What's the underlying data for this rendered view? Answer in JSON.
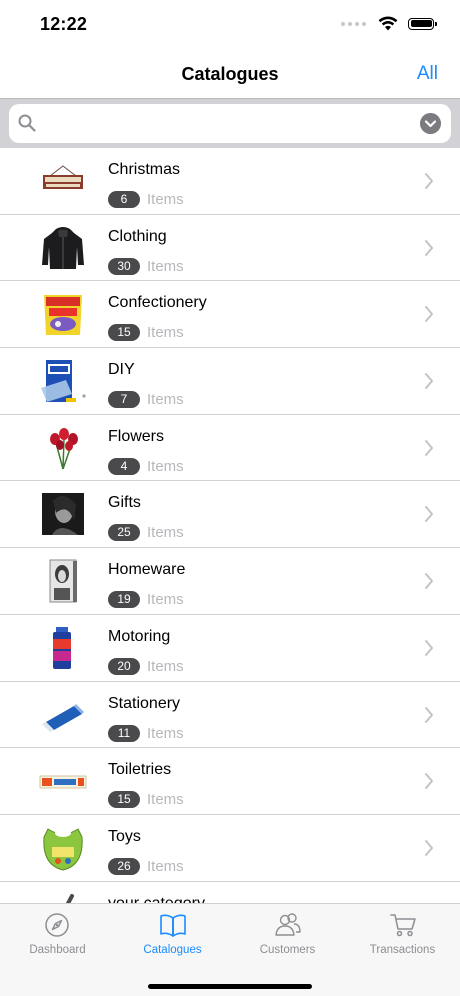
{
  "status_bar": {
    "time": "12:22"
  },
  "nav": {
    "title": "Catalogues",
    "right_button": "All"
  },
  "search": {
    "placeholder": "",
    "value": ""
  },
  "catalogues": [
    {
      "name": "Christmas",
      "count": "6",
      "items_label": "Items",
      "thumb": "be-merry-sign-thumbnail"
    },
    {
      "name": "Clothing",
      "count": "30",
      "items_label": "Items",
      "thumb": "hooded-jacket-thumbnail"
    },
    {
      "name": "Confectionery",
      "count": "15",
      "items_label": "Items",
      "thumb": "fries-sweets-thumbnail"
    },
    {
      "name": "DIY",
      "count": "7",
      "items_label": "Items",
      "thumb": "blu-tack-thumbnail"
    },
    {
      "name": "Flowers",
      "count": "4",
      "items_label": "Items",
      "thumb": "red-tulips-thumbnail"
    },
    {
      "name": "Gifts",
      "count": "25",
      "items_label": "Items",
      "thumb": "portrait-print-thumbnail"
    },
    {
      "name": "Homeware",
      "count": "19",
      "items_label": "Items",
      "thumb": "canvas-portrait-thumbnail"
    },
    {
      "name": "Motoring",
      "count": "20",
      "items_label": "Items",
      "thumb": "spray-can-thumbnail"
    },
    {
      "name": "Stationery",
      "count": "11",
      "items_label": "Items",
      "thumb": "eraser-thumbnail"
    },
    {
      "name": "Toiletries",
      "count": "15",
      "items_label": "Items",
      "thumb": "toothpaste-thumbnail"
    },
    {
      "name": "Toys",
      "count": "26",
      "items_label": "Items",
      "thumb": "baby-bib-thumbnail"
    },
    {
      "name": "your category",
      "count": "",
      "items_label": "",
      "thumb": "pen-thumbnail"
    }
  ],
  "tab_bar": {
    "tabs": [
      {
        "label": "Dashboard",
        "icon": "compass-icon",
        "active": false
      },
      {
        "label": "Catalogues",
        "icon": "open-book-icon",
        "active": true
      },
      {
        "label": "Customers",
        "icon": "people-icon",
        "active": false
      },
      {
        "label": "Transactions",
        "icon": "cart-icon",
        "active": false
      }
    ]
  },
  "colors": {
    "accent": "#1a8cff",
    "badge": "#4a4a4c",
    "inactive_tab": "#8e8e93"
  }
}
